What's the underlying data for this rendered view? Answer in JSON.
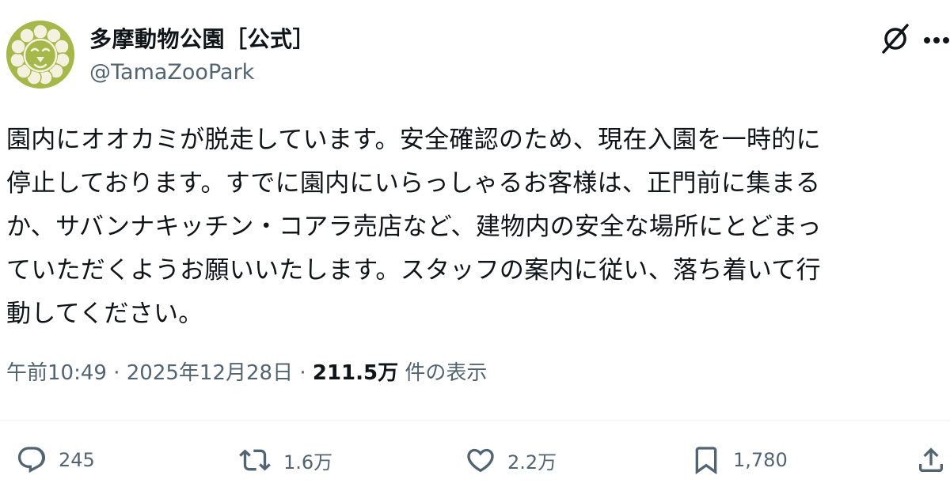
{
  "account": {
    "display_name": "多摩動物公園［公式］",
    "handle": "@TamaZooPark",
    "avatar_icon": "lion-face-icon",
    "avatar_color": "#a7b84a"
  },
  "post": {
    "lines": [
      "園内にオオカミが脱走しています。安全確認のため、現在入園を一時的に",
      "停止しております。すでに園内にいらっしゃるお客様は、正門前に集まる",
      "か、サバンナキッチン・コアラ売店など、建物内の安全な場所にとどまっ",
      "ていただくようお願いいたします。スタッフの案内に従い、落ち着いて行",
      "動してください。"
    ]
  },
  "meta": {
    "time": "午前10:49",
    "separator1": " · ",
    "date": "2025年12月28日",
    "separator2": " · ",
    "views_count": "211.5万",
    "views_label": " 件の表示"
  },
  "actions": {
    "replies": {
      "icon": "reply-icon",
      "count": "245"
    },
    "reposts": {
      "icon": "repost-icon",
      "count": "1.6万"
    },
    "likes": {
      "icon": "heart-icon",
      "count": "2.2万"
    },
    "bookmarks": {
      "icon": "bookmark-icon",
      "count": "1,780"
    },
    "share": {
      "icon": "share-icon"
    }
  },
  "header_icons": {
    "grok": "grok-icon",
    "more": "more-icon"
  },
  "colors": {
    "text_primary": "#0f1419",
    "text_secondary": "#536471",
    "divider": "#eff3f4"
  }
}
